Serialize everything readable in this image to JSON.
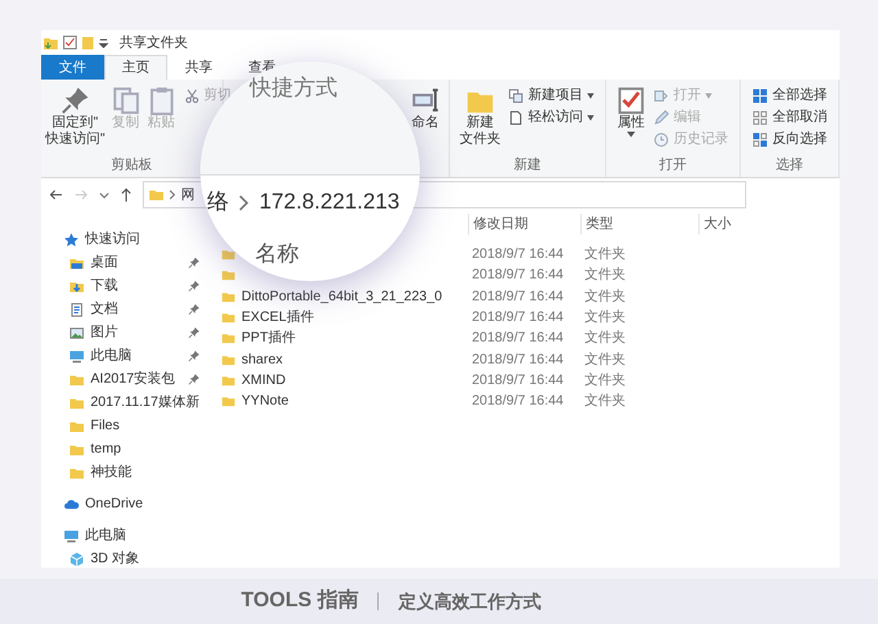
{
  "window": {
    "title": "共享文件夹"
  },
  "tabs": [
    {
      "label": "文件",
      "kind": "file",
      "selected": false
    },
    {
      "label": "主页",
      "kind": "tab",
      "selected": true
    },
    {
      "label": "共享",
      "kind": "tab",
      "selected": false
    },
    {
      "label": "查看",
      "kind": "tab",
      "selected": false
    }
  ],
  "ribbon": [
    {
      "label": "剪贴板",
      "items": [
        {
          "kind": "large",
          "lines": [
            "固定到\"",
            "快速访问\""
          ],
          "disabled": false
        },
        {
          "kind": "large",
          "lines": [
            "复制"
          ],
          "disabled": true
        },
        {
          "kind": "large",
          "lines": [
            "粘贴"
          ],
          "disabled": true
        },
        {
          "kind": "small",
          "lines": [
            "剪切"
          ],
          "disabled": true
        }
      ]
    },
    {
      "items": [
        {
          "kind": "large",
          "lines": [
            "命名"
          ],
          "disabled": false
        }
      ]
    },
    {
      "label": "新建",
      "items": [
        {
          "kind": "large",
          "lines": [
            "新建",
            "文件夹"
          ],
          "disabled": false
        },
        {
          "kind": "small",
          "lines": [
            "新建项目"
          ],
          "dropdown": true,
          "disabled": false
        },
        {
          "kind": "small",
          "lines": [
            "轻松访问"
          ],
          "dropdown": true,
          "disabled": false
        }
      ]
    },
    {
      "label": "打开",
      "items": [
        {
          "kind": "large",
          "lines": [
            "属性"
          ],
          "dropdown": true,
          "disabled": false
        },
        {
          "kind": "small",
          "lines": [
            "打开"
          ],
          "dropdown": true,
          "disabled": true
        },
        {
          "kind": "small",
          "lines": [
            "编辑"
          ],
          "disabled": true
        },
        {
          "kind": "small",
          "lines": [
            "历史记录"
          ],
          "disabled": true
        }
      ]
    },
    {
      "label": "选择",
      "items": [
        {
          "kind": "small",
          "lines": [
            "全部选择"
          ],
          "disabled": false
        },
        {
          "kind": "small",
          "lines": [
            "全部取消"
          ],
          "disabled": false
        },
        {
          "kind": "small",
          "lines": [
            "反向选择"
          ],
          "disabled": false
        }
      ]
    }
  ],
  "nav": {
    "back": {
      "disabled": false
    },
    "forward": {
      "disabled": true
    }
  },
  "address": {
    "crumbs": [
      "网"
    ]
  },
  "magnifier": {
    "ribbon_text": "快捷方式",
    "address": [
      "络",
      "172.8.221.213"
    ],
    "header": "名称"
  },
  "columns": [
    "修改日期",
    "类型",
    "大小"
  ],
  "rows": [
    {
      "date": "2018/9/7 16:44",
      "type": "文件夹"
    },
    {
      "date": "2018/9/7 16:44",
      "type": "文件夹"
    },
    {
      "name": "DittoPortable_64bit_3_21_223_0",
      "date": "2018/9/7 16:44",
      "type": "文件夹"
    },
    {
      "name": "EXCEL插件",
      "date": "2018/9/7 16:44",
      "type": "文件夹"
    },
    {
      "name": "PPT插件",
      "date": "2018/9/7 16:44",
      "type": "文件夹"
    },
    {
      "name": "sharex",
      "date": "2018/9/7 16:44",
      "type": "文件夹"
    },
    {
      "name": "XMIND",
      "date": "2018/9/7 16:44",
      "type": "文件夹"
    },
    {
      "name": "YYNote",
      "date": "2018/9/7 16:44",
      "type": "文件夹"
    }
  ],
  "sidebar": [
    {
      "label": "快速访问",
      "children": [
        {
          "label": "桌面",
          "pinned": true
        },
        {
          "label": "下载",
          "pinned": true
        },
        {
          "label": "文档",
          "pinned": true
        },
        {
          "label": "图片",
          "pinned": true
        },
        {
          "label": "此电脑",
          "pinned": true
        },
        {
          "label": "AI2017安装包",
          "pinned": true
        },
        {
          "label": "2017.11.17媒体新",
          "pinned": false
        },
        {
          "label": "Files",
          "pinned": false
        },
        {
          "label": "temp",
          "pinned": false
        },
        {
          "label": "神技能",
          "pinned": false
        }
      ]
    },
    {
      "label": "OneDrive"
    },
    {
      "label": "此电脑",
      "children": [
        {
          "label": "3D 对象"
        }
      ]
    }
  ],
  "footer": {
    "brand": "TOOLS 指南",
    "slogan": "定义高效工作方式"
  }
}
